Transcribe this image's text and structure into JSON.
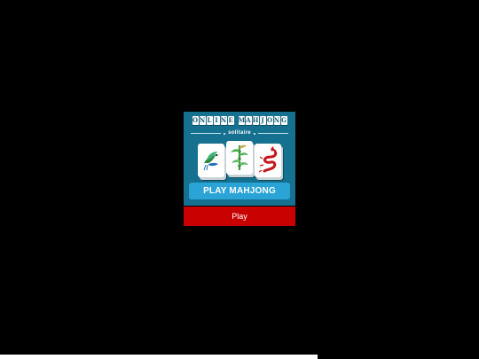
{
  "game_card": {
    "logo_title_letters": [
      "O",
      "N",
      "L",
      "I",
      "N",
      "E",
      " ",
      "M",
      "A",
      "H",
      "J",
      "O",
      "N",
      "G"
    ],
    "logo_subtitle": "solitaire",
    "banner_label": "PLAY MAHJONG",
    "tiles": [
      "bird-tile-icon",
      "bamboo-tile-icon",
      "dragon-tile-icon"
    ]
  },
  "play_button": {
    "label": "Play"
  },
  "colors": {
    "background": "#000000",
    "card": "#16708f",
    "banner": "#2aa3d6",
    "play_button": "#c90000",
    "dragon": "#c4161c",
    "bird": "#2b8a3e",
    "bamboo": "#3a9a3a"
  }
}
